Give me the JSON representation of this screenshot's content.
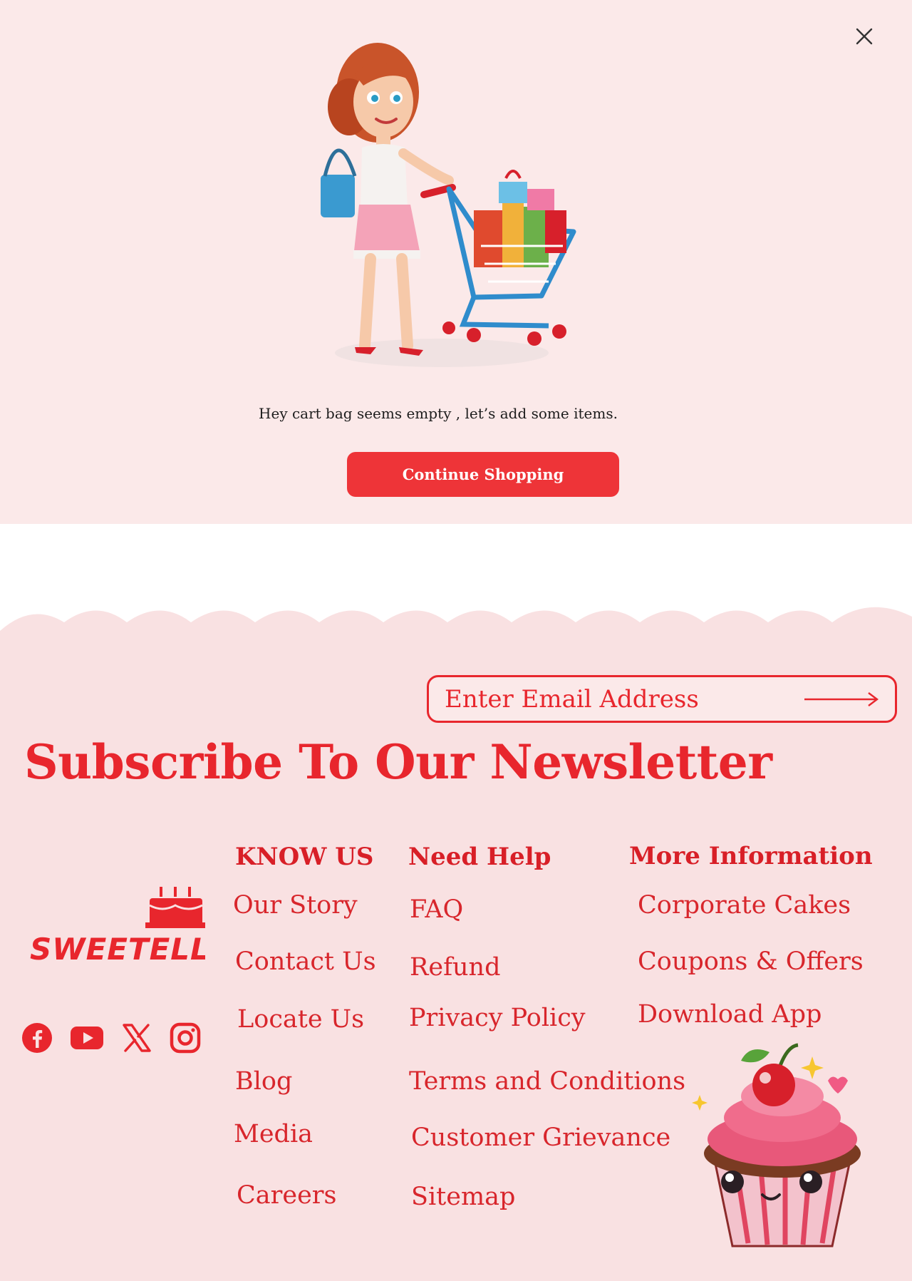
{
  "cart": {
    "close_label": "close",
    "close_icon": "close-icon",
    "illustration": "shopping-woman-cart-illustration",
    "message": "Hey cart bag seems empty , let’s add some items.",
    "continue_label": "Continue Shopping"
  },
  "newsletter": {
    "email_placeholder": "Enter Email Address",
    "submit_icon": "arrow-right-icon",
    "title": "Subscribe To Our Newsletter"
  },
  "brand": {
    "logo_text": "SWEETELLA",
    "logo_icon": "cake-icon"
  },
  "social": [
    {
      "name": "facebook-icon"
    },
    {
      "name": "youtube-icon"
    },
    {
      "name": "x-icon"
    },
    {
      "name": "instagram-icon"
    }
  ],
  "columns": {
    "know_us": {
      "heading": "KNOW US",
      "links": [
        "Our Story",
        "Contact Us",
        "Locate Us",
        "Blog",
        "Media",
        "Careers"
      ]
    },
    "need_help": {
      "heading": "Need Help",
      "links": [
        "FAQ",
        "Refund",
        "Privacy Policy",
        "Terms and Conditions",
        "Customer Grievance",
        "Sitemap"
      ]
    },
    "more_info": {
      "heading": "More Information",
      "links": [
        "Corporate Cakes",
        "Coupons  & Offers",
        "Download App"
      ]
    }
  },
  "decor": {
    "cupcake": "cherry-cupcake-mascot"
  },
  "colors": {
    "brand_red": "#e8262d",
    "button_red": "#ee3438",
    "panel_bg": "#fbe9e9",
    "footer_bg": "#f9e1e2"
  }
}
